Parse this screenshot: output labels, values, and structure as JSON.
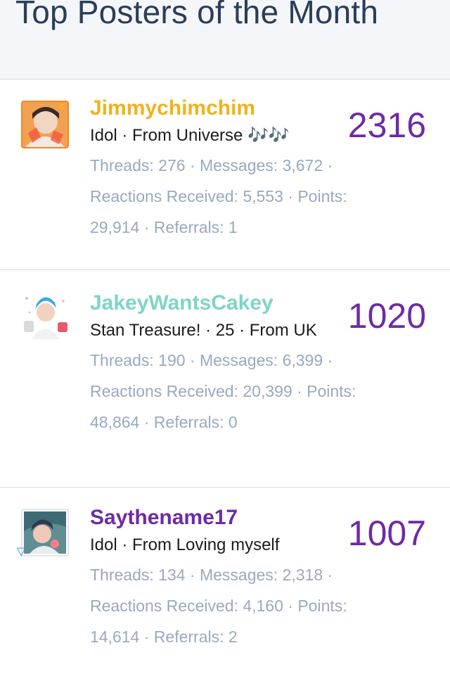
{
  "page": {
    "title": "Top Posters of the Month"
  },
  "posters": [
    {
      "username": "Jimmychimchim",
      "user_title": "Idol · From Universe 🎶🎶",
      "stats": "Threads: 276 · Messages: 3,672 · Reactions Received: 5,553 · Points: 29,914 · Referrals: 1",
      "count": "2316",
      "name_color": "#f0b21e",
      "avatar": "user-photo-orange-frame"
    },
    {
      "username": "JakeyWantsCakey",
      "user_title": "Stan Treasure! · 25 · From UK",
      "stats": "Threads: 190 · Messages: 6,399 · Reactions Received: 20,399 · Points: 48,864 · Referrals: 0",
      "count": "1020",
      "name_color": "#7fd5c5",
      "avatar": "user-photo-blue-hair"
    },
    {
      "username": "Saythename17",
      "user_title": "Idol · From Loving myself",
      "stats": "Threads: 134 · Messages: 2,318 · Reactions Received: 4,160 · Points: 14,614 · Referrals: 2",
      "count": "1007",
      "name_color": "#6f2aa6",
      "avatar": "user-photo-teal"
    }
  ],
  "colors": {
    "accent_count": "#6f2aa6",
    "stats_text": "#9aa9bf",
    "header_bg": "#f4f6fa",
    "divider": "#d6dfe9"
  }
}
